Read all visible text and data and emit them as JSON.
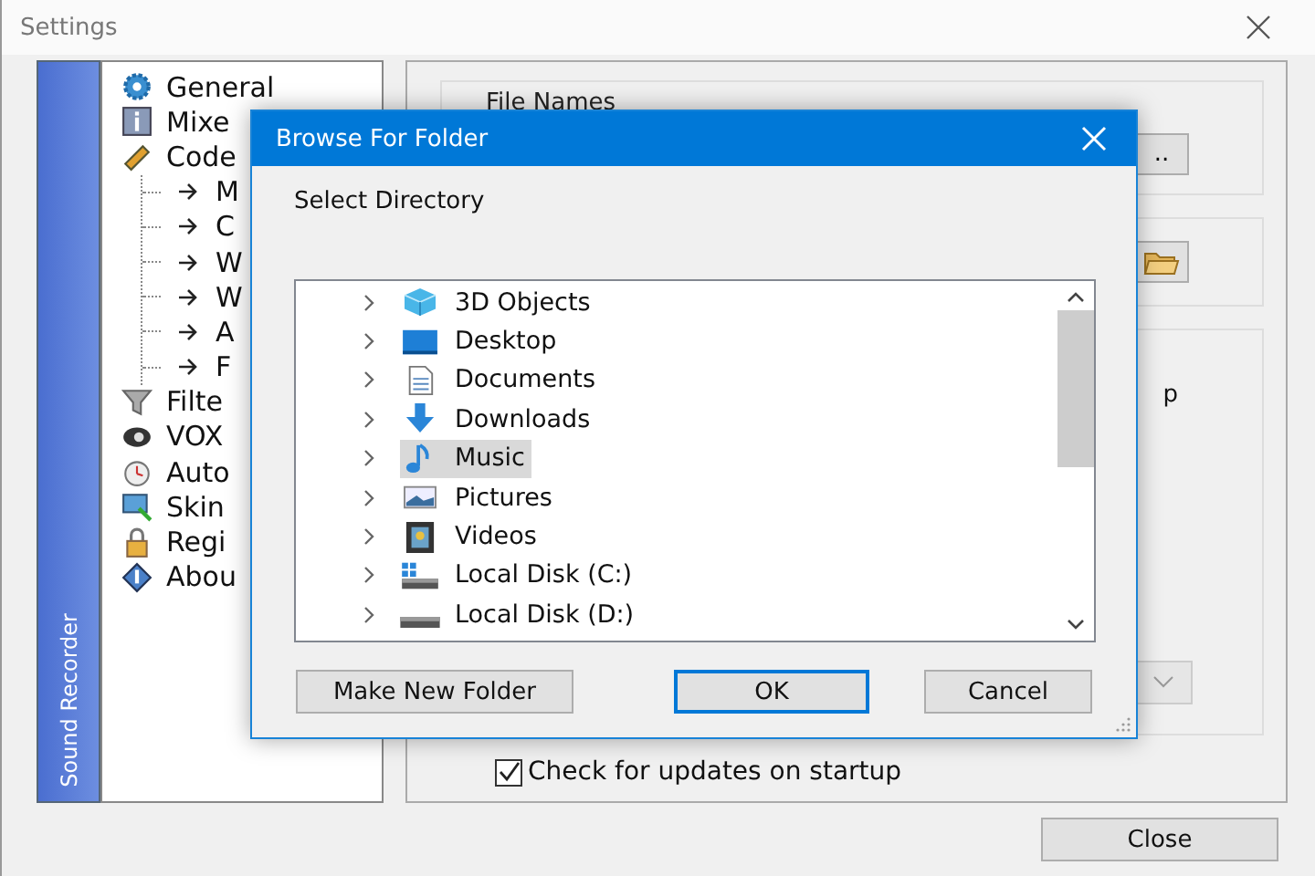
{
  "window": {
    "title": "Settings"
  },
  "sidebar": {
    "caption": "Sound Recorder",
    "items": [
      {
        "label": "General",
        "selected": false
      },
      {
        "label": "Mixe",
        "selected": false
      },
      {
        "label": "Code",
        "selected": false,
        "children": [
          {
            "label": "M"
          },
          {
            "label": "C"
          },
          {
            "label": "W"
          },
          {
            "label": "W"
          },
          {
            "label": "A"
          },
          {
            "label": "F"
          }
        ]
      },
      {
        "label": "Filte",
        "selected": false
      },
      {
        "label": "VOX",
        "selected": false
      },
      {
        "label": "Auto",
        "selected": false
      },
      {
        "label": "Skin",
        "selected": false
      },
      {
        "label": "Regi",
        "selected": false
      },
      {
        "label": "Abou",
        "selected": false
      }
    ]
  },
  "panel": {
    "group_label": "File Names",
    "browse_button": "..",
    "cut_text": "p",
    "update_check": {
      "label": "Check for updates on startup",
      "checked": true
    }
  },
  "close_button": "Close",
  "dialog": {
    "title": "Browse For Folder",
    "prompt": "Select Directory",
    "folders": [
      {
        "label": "3D Objects",
        "selected": false,
        "expanded": false
      },
      {
        "label": "Desktop",
        "selected": false,
        "expanded": false
      },
      {
        "label": "Documents",
        "selected": false,
        "expanded": false
      },
      {
        "label": "Downloads",
        "selected": false,
        "expanded": false
      },
      {
        "label": "Music",
        "selected": true,
        "expanded": false
      },
      {
        "label": "Pictures",
        "selected": false,
        "expanded": false
      },
      {
        "label": "Videos",
        "selected": false,
        "expanded": false
      },
      {
        "label": "Local Disk (C:)",
        "selected": false,
        "expanded": false
      },
      {
        "label": "Local Disk (D:)",
        "selected": false,
        "expanded": false
      }
    ],
    "buttons": [
      {
        "label": "Make New Folder",
        "focused": false
      },
      {
        "label": "OK",
        "focused": true
      },
      {
        "label": "Cancel",
        "focused": false
      }
    ]
  }
}
